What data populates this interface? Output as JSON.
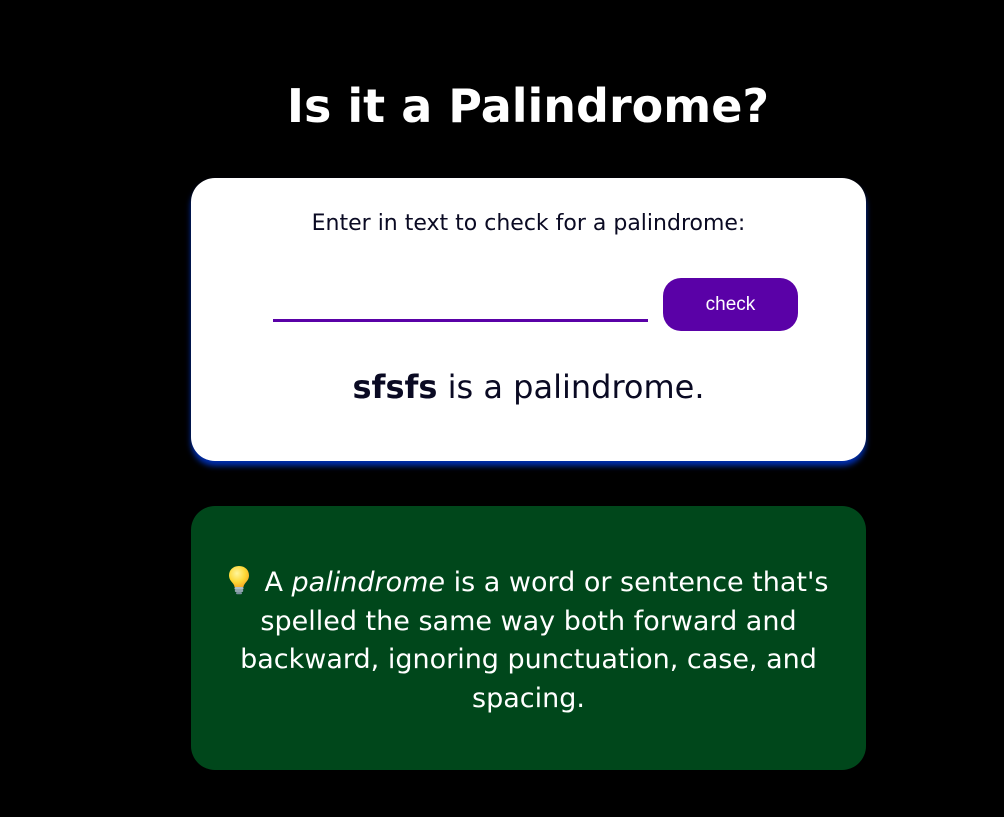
{
  "page": {
    "title": "Is it a Palindrome?"
  },
  "checker": {
    "prompt_label": "Enter in text to check for a palindrome:",
    "input_value": "",
    "input_placeholder": "",
    "check_button_label": "check",
    "result": {
      "word": "sfsfs",
      "message": " is a palindrome."
    }
  },
  "info": {
    "icon": "lightbulb-icon",
    "prefix": "A ",
    "term": "palindrome",
    "definition": " is a word or sentence that's spelled the same way both forward and backward, ignoring punctuation, case, and spacing."
  },
  "colors": {
    "background": "#000000",
    "accent": "#5a01a7",
    "info_background": "#00471b",
    "card_shadow": "#002ead"
  }
}
